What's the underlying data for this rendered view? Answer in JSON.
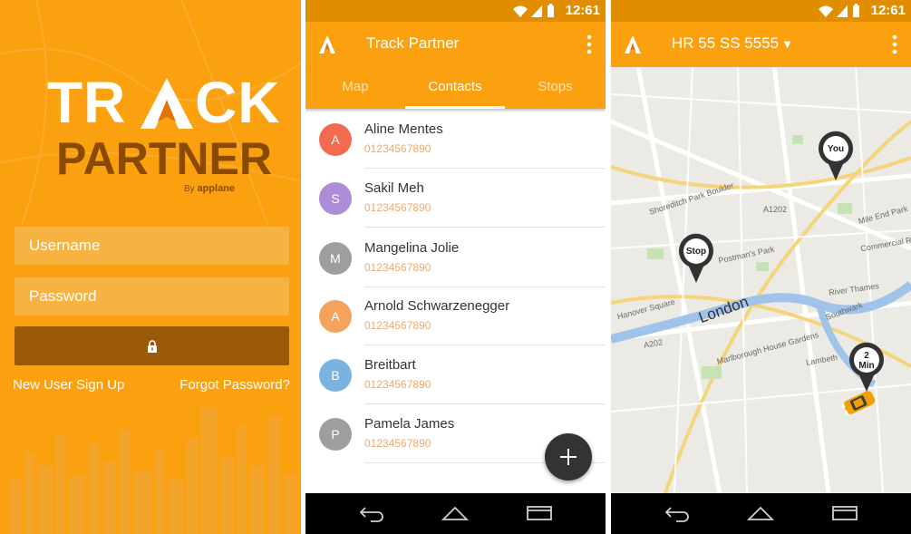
{
  "login": {
    "logo_track_part1": "TR",
    "logo_track_part2": "CK",
    "logo_partner": "PARTNER",
    "logo_by": "By",
    "logo_brand": "applane",
    "username_placeholder": "Username",
    "password_placeholder": "Password",
    "signup_link": "New User Sign Up",
    "forgot_link": "Forgot Password?",
    "login_button_icon": "lock-icon",
    "background_color": "#fba10f"
  },
  "status_bar": {
    "time": "12:61",
    "icons": [
      "wifi-icon",
      "signal-icon",
      "battery-icon"
    ]
  },
  "contacts_screen": {
    "app_title": "Track Partner",
    "tabs": [
      {
        "label": "Map",
        "active": false
      },
      {
        "label": "Contacts",
        "active": true
      },
      {
        "label": "Stops",
        "active": false
      }
    ],
    "contacts": [
      {
        "initial": "A",
        "name": "Aline Mentes",
        "phone": "01234567890",
        "color": "#f26b4f"
      },
      {
        "initial": "S",
        "name": "Sakil Meh",
        "phone": "01234567890",
        "color": "#ad8ed6"
      },
      {
        "initial": "M",
        "name": "Mangelina Jolie",
        "phone": "01234567890",
        "color": "#9e9e9e"
      },
      {
        "initial": "A",
        "name": "Arnold Schwarzenegger",
        "phone": "01234567890",
        "color": "#f3a35c"
      },
      {
        "initial": "B",
        "name": "Breitbart",
        "phone": "01234567890",
        "color": "#7ab3df"
      },
      {
        "initial": "P",
        "name": "Pamela James",
        "phone": "01234567890",
        "color": "#9e9e9e"
      }
    ],
    "fab_icon": "plus-icon"
  },
  "map_screen": {
    "vehicle_title": "HR 55 SS 5555",
    "caret": "▼",
    "pins": [
      {
        "label_lines": [
          "You"
        ],
        "name": "you"
      },
      {
        "label_lines": [
          "Stop"
        ],
        "name": "stop"
      },
      {
        "label_lines": [
          "2",
          "Min"
        ],
        "name": "eta"
      }
    ],
    "city_label": "London",
    "street_labels": [
      "Shoreditch Park Boulder",
      "Hanover Square",
      "Postman's Park",
      "River Thames",
      "Southwark",
      "Marlborough House Gardens",
      "Mile End Park",
      "Commercial Rd",
      "Lambeth",
      "A202",
      "A1202"
    ]
  },
  "nav_bar": {
    "icons": [
      "back-icon",
      "home-icon",
      "recents-icon"
    ]
  },
  "colors": {
    "accent": "#fba10f",
    "status_bar": "#e08e00",
    "login_button": "#9b5a07",
    "phone_text": "#f2a96a",
    "fab": "#333333"
  }
}
